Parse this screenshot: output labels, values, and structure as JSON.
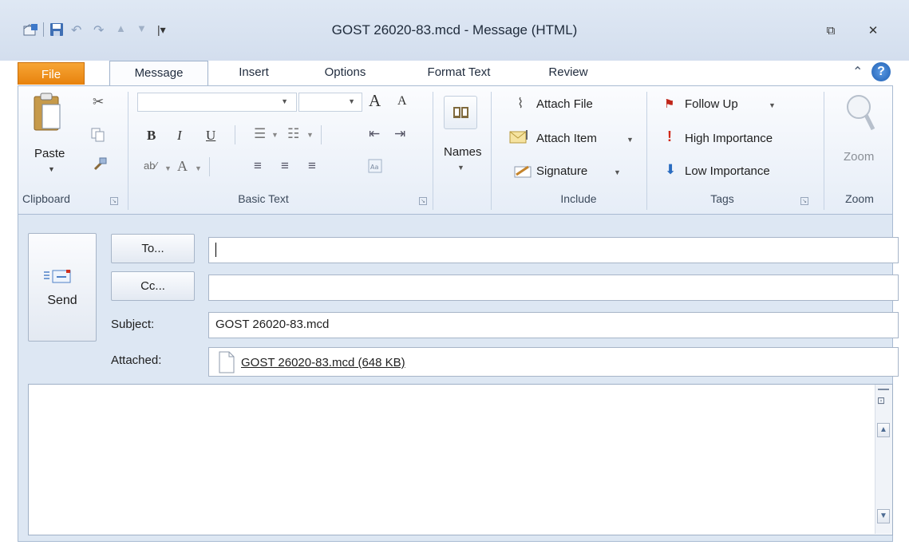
{
  "window": {
    "title": "GOST 26020-83.mcd  -  Message (HTML)",
    "restore_glyph": "⧉",
    "close_glyph": "✕"
  },
  "quick_access": {
    "more_glyph": "|▾"
  },
  "tabs": [
    "File",
    "Message",
    "Insert",
    "Options",
    "Format Text",
    "Review"
  ],
  "ribbon_right": {
    "collapse_glyph": "⌃",
    "help_glyph": "?"
  },
  "clipboard": {
    "paste_label": "Paste",
    "group_label": "Clipboard"
  },
  "basic_text": {
    "font_name": "",
    "font_size": "",
    "bold": "B",
    "italic": "I",
    "underline": "U",
    "grow_font": "A",
    "shrink_font": "A",
    "font_color": "A",
    "group_label": "Basic Text"
  },
  "names": {
    "label": "Names"
  },
  "include": {
    "attach_file": "Attach File",
    "attach_item": "Attach Item",
    "signature": "Signature",
    "group_label": "Include"
  },
  "tags": {
    "follow_up": "Follow Up",
    "high_importance": "High Importance",
    "low_importance": "Low Importance",
    "group_label": "Tags"
  },
  "zoom": {
    "label": "Zoom",
    "group_label": "Zoom"
  },
  "compose": {
    "send_label": "Send",
    "to_button": "To...",
    "cc_button": "Cc...",
    "to_value": "",
    "cc_value": "",
    "subject_label": "Subject:",
    "subject_value": "GOST 26020-83.mcd",
    "attached_label": "Attached:",
    "attachment_name": "GOST 26020-83.mcd (648 KB)",
    "body_text": ""
  },
  "colors": {
    "file_tab": "#e7820d",
    "ribbon_bg": "#e6edf7",
    "accent_blue": "#2a6cc0"
  }
}
